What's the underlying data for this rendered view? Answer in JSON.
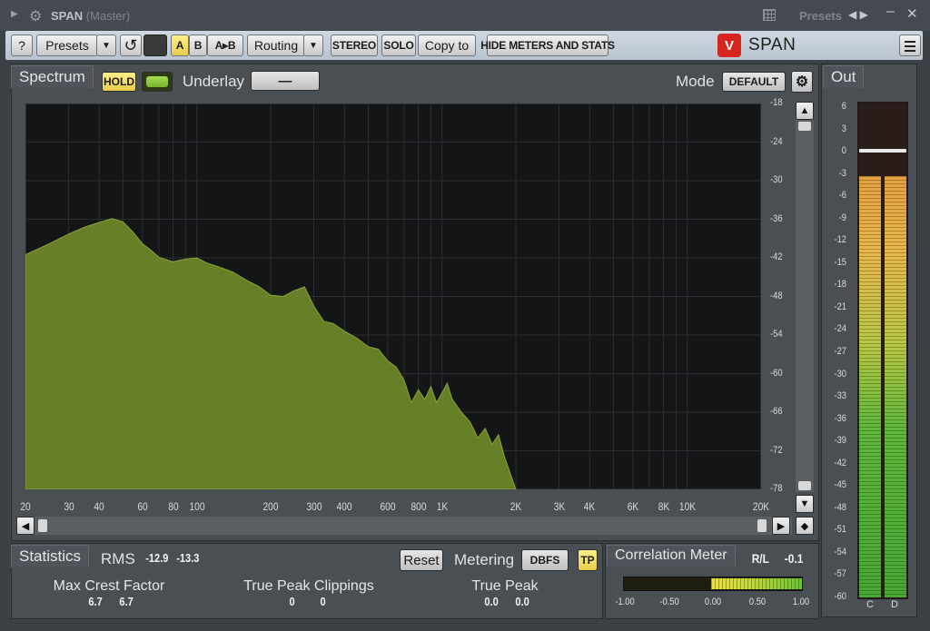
{
  "window": {
    "title": "SPAN",
    "subtitle": "(Master)",
    "presets_label": "Presets"
  },
  "toolbar": {
    "help": "?",
    "presets": "Presets",
    "dropdown": "▼",
    "undo": "↺",
    "a": "A",
    "b": "B",
    "ab": "A▸B",
    "routing": "Routing",
    "stereo": "STEREO",
    "solo": "SOLO",
    "copy_to": "Copy to",
    "hide_meters": "HIDE METERS AND STATS",
    "brand": "SPAN",
    "logo": "V"
  },
  "spectrum": {
    "tab": "Spectrum",
    "hold": "HOLD",
    "underlay_label": "Underlay",
    "underlay_value": "—",
    "mode_label": "Mode",
    "mode_value": "DEFAULT",
    "y_labels": [
      "-18",
      "-24",
      "-30",
      "-36",
      "-42",
      "-48",
      "-54",
      "-60",
      "-66",
      "-72",
      "-78"
    ],
    "x_labels": [
      "20",
      "30",
      "40",
      "60",
      "80",
      "100",
      "200",
      "300",
      "400",
      "600",
      "800",
      "1K",
      "2K",
      "3K",
      "4K",
      "6K",
      "8K",
      "10K",
      "20K"
    ],
    "x_values": [
      20,
      30,
      40,
      60,
      80,
      100,
      200,
      300,
      400,
      600,
      800,
      1000,
      2000,
      3000,
      4000,
      6000,
      8000,
      10000,
      20000
    ]
  },
  "chart_data": {
    "type": "area",
    "xscale": "log",
    "xlim": [
      20,
      20000
    ],
    "ylim": [
      -78,
      -18
    ],
    "xlabel": "",
    "ylabel": "",
    "grid": true,
    "series": [
      {
        "color": "#6f8a2a",
        "x": [
          20,
          25,
          30,
          35,
          40,
          45,
          50,
          55,
          60,
          65,
          70,
          80,
          90,
          100,
          110,
          125,
          140,
          160,
          180,
          200,
          225,
          250,
          275,
          300,
          330,
          360,
          400,
          450,
          500,
          550,
          600,
          650,
          700,
          750,
          800,
          850,
          900,
          950,
          1000,
          1050,
          1100,
          1200,
          1300,
          1400,
          1500,
          1600,
          1700,
          1800,
          2000
        ],
        "y": [
          -41.5,
          -39.8,
          -38.3,
          -37.2,
          -36.5,
          -35.9,
          -36.4,
          -38.0,
          -39.8,
          -40.8,
          -41.9,
          -42.6,
          -42.2,
          -42.0,
          -42.8,
          -43.5,
          -44.2,
          -45.5,
          -46.5,
          -47.8,
          -48.0,
          -47.1,
          -46.5,
          -49.5,
          -51.9,
          -52.2,
          -53.4,
          -54.5,
          -55.8,
          -56.2,
          -58.0,
          -59.0,
          -61.0,
          -64.5,
          -62.5,
          -64.0,
          -62.0,
          -64.5,
          -63.0,
          -61.5,
          -64.0,
          -66.0,
          -67.5,
          -70.0,
          -68.5,
          -71.0,
          -69.5,
          -73.0,
          -78.0
        ]
      }
    ]
  },
  "out_meter": {
    "tab": "Out",
    "ticks": [
      "6",
      "3",
      "0",
      "-3",
      "-6",
      "-9",
      "-12",
      "-15",
      "-18",
      "-21",
      "-24",
      "-27",
      "-30",
      "-33",
      "-36",
      "-39",
      "-42",
      "-45",
      "-48",
      "-51",
      "-54",
      "-57",
      "-60"
    ],
    "channels": [
      "C",
      "D"
    ]
  },
  "statistics": {
    "tab": "Statistics",
    "rms_label": "RMS",
    "rms_values": [
      "-12.9",
      "-13.3"
    ],
    "reset": "Reset",
    "metering_label": "Metering",
    "metering_value": "DBFS",
    "tp": "TP",
    "crest_label": "Max Crest Factor",
    "crest_values": [
      "6.7",
      "6.7"
    ],
    "clip_label": "True Peak Clippings",
    "clip_values": [
      "0",
      "0"
    ],
    "peak_label": "True Peak",
    "peak_values": [
      "0.0",
      "0.0"
    ]
  },
  "correlation": {
    "tab": "Correlation Meter",
    "rl_label": "R/L",
    "rl_value": "-0.1",
    "ticks": [
      "-1.00",
      "-0.50",
      "0.00",
      "0.50",
      "1.00"
    ]
  }
}
